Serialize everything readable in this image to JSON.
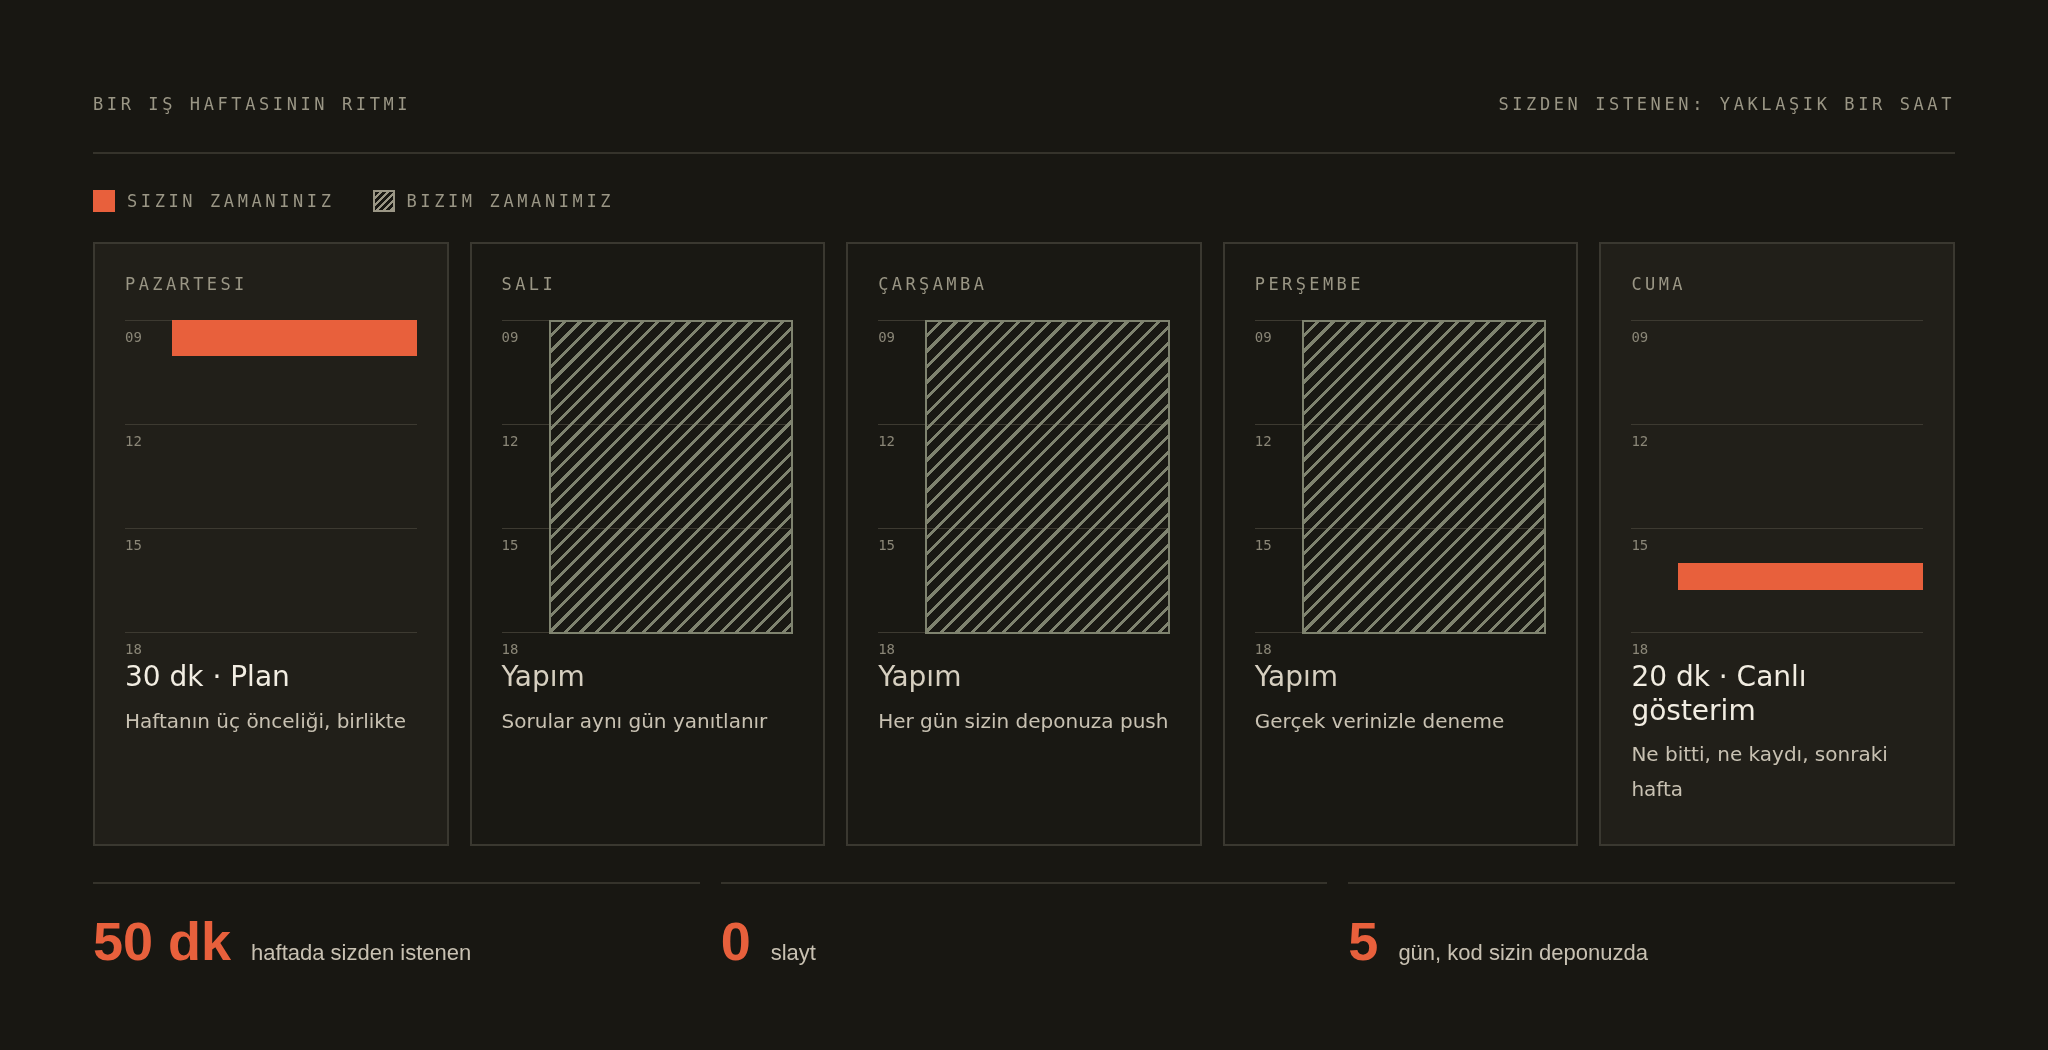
{
  "header": {
    "title": "BIR IŞ HAFTASININ RITMI",
    "note": "SIZDEN ISTENEN: YAKLAŞIK BIR SAAT"
  },
  "legend": [
    {
      "kind": "yours",
      "label": "SIZIN ZAMANINIZ"
    },
    {
      "kind": "ours",
      "label": "BIZIM ZAMANIMIZ"
    }
  ],
  "days": [
    {
      "name": "PAZARTESI",
      "hours": [
        "09",
        "12",
        "15",
        "18"
      ],
      "block": {
        "kind": "morning"
      },
      "title": "30 dk · Plan",
      "description": "Haftanın üç önceliği, birlikte"
    },
    {
      "name": "SALI",
      "hours": [
        "09",
        "12",
        "15",
        "18"
      ],
      "block": {
        "kind": "full"
      },
      "title": "Yapım",
      "description": "Sorular aynı gün yanıtlanır"
    },
    {
      "name": "ÇARŞAMBA",
      "hours": [
        "09",
        "12",
        "15",
        "18"
      ],
      "block": {
        "kind": "full"
      },
      "title": "Yapım",
      "description": "Her gün sizin deponuza push"
    },
    {
      "name": "PERŞEMBE",
      "hours": [
        "09",
        "12",
        "15",
        "18"
      ],
      "block": {
        "kind": "full"
      },
      "title": "Yapım",
      "description": "Gerçek verinizle deneme"
    },
    {
      "name": "CUMA",
      "hours": [
        "09",
        "12",
        "15",
        "18"
      ],
      "block": {
        "kind": "late"
      },
      "title": "20 dk · Canlı gösterim",
      "description": "Ne bitti, ne kaydı, sonraki hafta"
    }
  ],
  "stats": [
    {
      "value": "50 dk",
      "label": "haftada sizden istenen"
    },
    {
      "value": "0",
      "label": "slayt"
    },
    {
      "value": "5",
      "label": "gün, kod sizin deponuzda"
    }
  ]
}
